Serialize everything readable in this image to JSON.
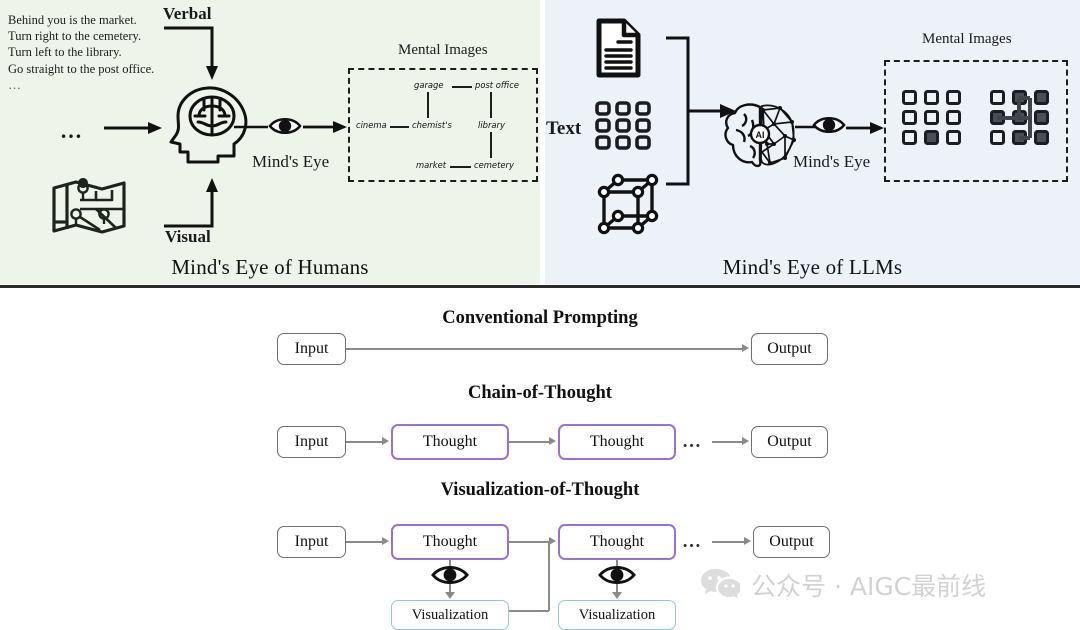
{
  "figure": {
    "top": {
      "human_panel": {
        "caption": "Mind's Eye of Humans",
        "nav_instructions": [
          "Behind you is the market.",
          "Turn right to the cemetery.",
          "Turn left to the library.",
          "Go straight to the post office."
        ],
        "nav_ellipsis": "…",
        "flow_ellipsis": "…",
        "verbal_label": "Verbal",
        "visual_label": "Visual",
        "minds_eye_label": "Mind's Eye",
        "mental_images_label": "Mental Images",
        "map_icon": "folded-map-icon",
        "head_icon": "human-head-brain-icon",
        "eye_icon": "eye-icon",
        "mental_map_nodes": [
          "garage",
          "post office",
          "cinema",
          "chemist's",
          "library",
          "market",
          "cemetery"
        ],
        "mental_map_edges": [
          "garage-post office",
          "garage-chemist's",
          "cinema-chemist's",
          "post office-library",
          "library-cemetery",
          "market-cemetery"
        ],
        "bg_color": "#eef4ea"
      },
      "llm_panel": {
        "caption": "Mind's Eye of LLMs",
        "text_label": "Text",
        "minds_eye_label": "Mind's Eye",
        "mental_images_label": "Mental Images",
        "doc_icon": "document-icon",
        "grid_icon": "grid-3x3-icon",
        "cube_icon": "wireframe-cube-icon",
        "brain_icon": "ai-brain-network-icon",
        "eye_icon": "eye-icon",
        "grid_ellipsis": "…",
        "grid_before": [
          [
            0,
            0,
            0
          ],
          [
            0,
            0,
            0
          ],
          [
            0,
            1,
            0
          ]
        ],
        "grid_after": [
          [
            0,
            1,
            1
          ],
          [
            1,
            1,
            1
          ],
          [
            0,
            1,
            1
          ]
        ],
        "bg_color": "#edf2f8"
      }
    },
    "bottom": {
      "rows": [
        {
          "title": "Conventional Prompting",
          "input_label": "Input",
          "output_label": "Output"
        },
        {
          "title": "Chain-of-Thought",
          "input_label": "Input",
          "thought_label_1": "Thought",
          "thought_label_2": "Thought",
          "ellipsis": "…",
          "output_label": "Output"
        },
        {
          "title": "Visualization-of-Thought",
          "input_label": "Input",
          "thought_label_1": "Thought",
          "thought_label_2": "Thought",
          "visualization_label_1": "Visualization",
          "visualization_label_2": "Visualization",
          "ellipsis": "…",
          "output_label": "Output",
          "eye_icon": "eye-icon"
        }
      ],
      "colors": {
        "thought_border": "#9b6fd4",
        "visualization_border": "#8ec8e8",
        "plain_border": "#6f6f6f",
        "arrow": "#8a8a8a"
      }
    },
    "watermark": {
      "icon": "wechat-icon",
      "text": "公众号 · AIGC最前线"
    }
  }
}
